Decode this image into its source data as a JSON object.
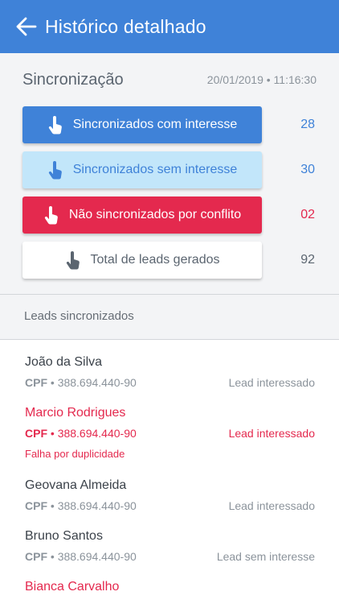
{
  "header": {
    "title": "Histórico detalhado"
  },
  "sync": {
    "title": "Sincronização",
    "date": "20/01/2019 • 11:16:30",
    "buttons": [
      {
        "label": "Sincronizados com interesse",
        "count": "28",
        "color": "#3f82d8"
      },
      {
        "label": "Sincronizados sem interesse",
        "count": "30",
        "color": "#c2e6fa"
      },
      {
        "label": "Não sincronizados por conflito",
        "count": "02",
        "color": "#e4294e"
      },
      {
        "label": "Total de leads gerados",
        "count": "92",
        "color": "#ffffff"
      }
    ]
  },
  "leads_section": {
    "title": "Leads sincronizados"
  },
  "leads": [
    {
      "name": "João da Silva",
      "cpf_label": "CPF",
      "cpf": "388.694.440-90",
      "status": "Lead interessado",
      "error": ""
    },
    {
      "name": "Marcio Rodrigues",
      "cpf_label": "CPF",
      "cpf": "388.694.440-90",
      "status": "Lead interessado",
      "error": "Falha por duplicidade"
    },
    {
      "name": "Geovana Almeida",
      "cpf_label": "CPF",
      "cpf": "388.694.440-90",
      "status": "Lead interessado",
      "error": ""
    },
    {
      "name": "Bruno Santos",
      "cpf_label": "CPF",
      "cpf": "388.694.440-90",
      "status": "Lead sem interesse",
      "error": ""
    },
    {
      "name": "Bianca Carvalho",
      "cpf_label": "",
      "cpf": "",
      "status": "",
      "error": ""
    }
  ],
  "icons": {
    "back": "arrow-left-icon",
    "touch": "hand-pointer-icon"
  }
}
